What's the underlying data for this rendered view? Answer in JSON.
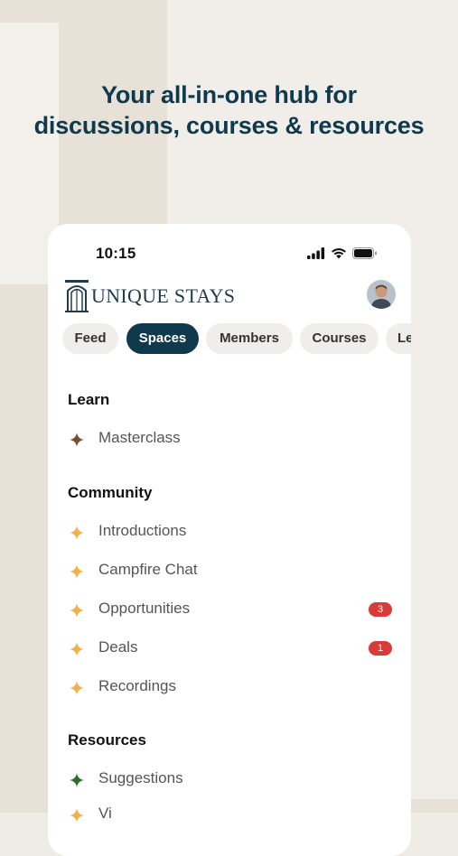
{
  "headline": {
    "line1": "Your all-in-one hub for",
    "line2": "discussions, courses & resources"
  },
  "status_bar": {
    "time": "10:15"
  },
  "brand": {
    "name": "UNIQUE STAYS"
  },
  "tabs": [
    {
      "label": "Feed",
      "active": false
    },
    {
      "label": "Spaces",
      "active": true
    },
    {
      "label": "Members",
      "active": false
    },
    {
      "label": "Courses",
      "active": false
    },
    {
      "label": "Le",
      "active": false
    }
  ],
  "sections": {
    "learn": {
      "title": "Learn",
      "items": [
        {
          "label": "Masterclass",
          "icon": "sparkle-icon",
          "color": "#7a4e2d"
        }
      ]
    },
    "community": {
      "title": "Community",
      "items": [
        {
          "label": "Introductions",
          "icon": "sparkle-icon",
          "color": "#f2b04a"
        },
        {
          "label": "Campfire Chat",
          "icon": "sparkle-icon",
          "color": "#f2b04a"
        },
        {
          "label": "Opportunities",
          "icon": "sparkle-icon",
          "color": "#f2b04a",
          "badge": "3"
        },
        {
          "label": "Deals",
          "icon": "sparkle-icon",
          "color": "#f2b04a",
          "badge": "1"
        },
        {
          "label": "Recordings",
          "icon": "sparkle-icon",
          "color": "#f2b04a"
        }
      ]
    },
    "resources": {
      "title": "Resources",
      "items": [
        {
          "label": "Suggestions",
          "icon": "sparkle-icon",
          "color": "#2d6b2a"
        },
        {
          "label": "Vi",
          "icon": "sparkle-icon",
          "color": "#f2b04a"
        }
      ]
    }
  },
  "colors": {
    "brand_navy": "#0f3a4d",
    "badge_red": "#d93a3a",
    "background": "#efebe5"
  }
}
